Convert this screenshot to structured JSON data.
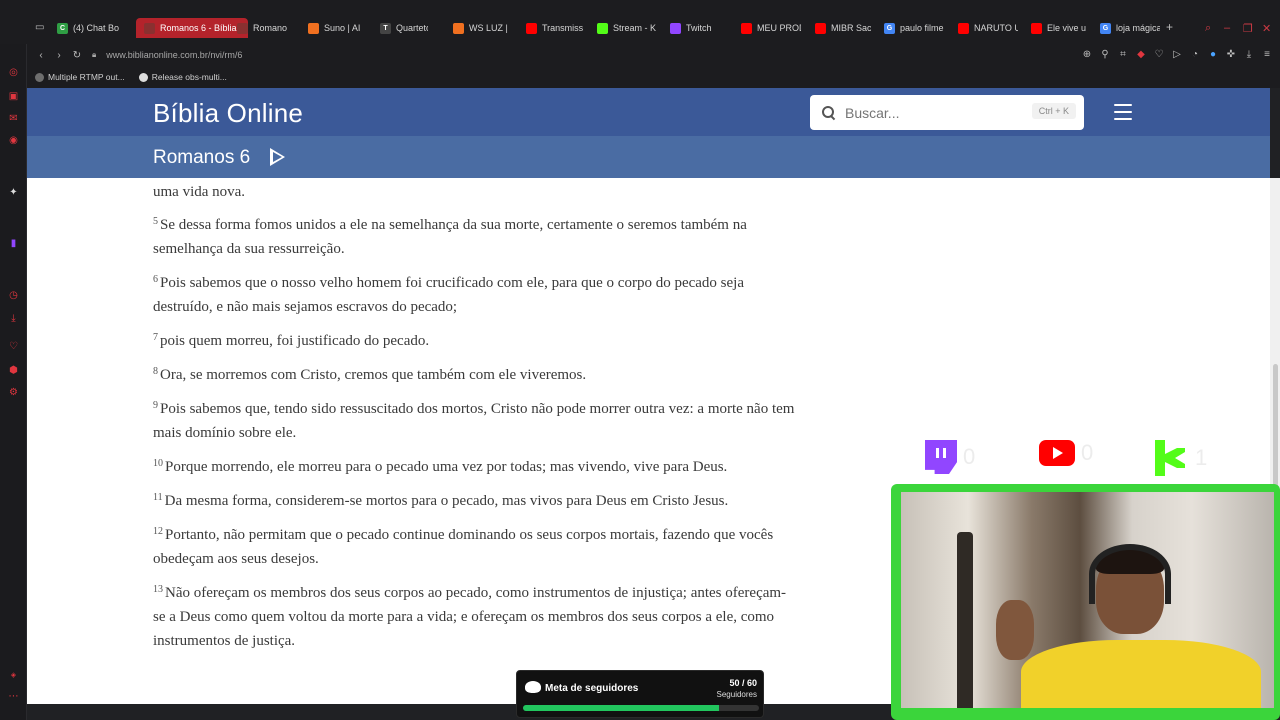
{
  "tabs": [
    {
      "label": "(4) Chat Bo",
      "color": "#2f9e44",
      "glyph": "C"
    },
    {
      "label": "Romanos 6 - Bíblia",
      "color": "#8a3030",
      "glyph": "",
      "active": true
    },
    {
      "label": "Romanos",
      "color": "#8a3030",
      "glyph": ""
    },
    {
      "label": "Suno | AI M",
      "color": "#f07020",
      "glyph": ""
    },
    {
      "label": "Quarteto",
      "color": "#444",
      "glyph": "T"
    },
    {
      "label": "WS LUZ |",
      "color": "#f07020",
      "glyph": ""
    },
    {
      "label": "Transmiss",
      "color": "#ff0000",
      "glyph": ""
    },
    {
      "label": "Stream - K",
      "color": "#53fc18",
      "glyph": ""
    },
    {
      "label": "Twitch",
      "color": "#9146ff",
      "glyph": ""
    },
    {
      "label": "MEU PROD",
      "color": "#ff0000",
      "glyph": ""
    },
    {
      "label": "MIBR Sacy",
      "color": "#ff0000",
      "glyph": ""
    },
    {
      "label": "paulo filme",
      "color": "#4285f4",
      "glyph": "G"
    },
    {
      "label": "NARUTO U",
      "color": "#ff0000",
      "glyph": ""
    },
    {
      "label": "Ele vive u",
      "color": "#ff0000",
      "glyph": ""
    },
    {
      "label": "loja mágica",
      "color": "#4285f4",
      "glyph": "G"
    }
  ],
  "browser": {
    "url": "www.biblianonline.com.br/nvi/rm/6"
  },
  "bookmarks": [
    {
      "label": "Multiple RTMP out..."
    },
    {
      "label": "Release obs-multi..."
    }
  ],
  "site": {
    "title": "Bíblia Online",
    "search_placeholder": "Buscar...",
    "search_shortcut": "Ctrl + K",
    "chapter": "Romanos 6"
  },
  "partial_verse": "uma vida nova.",
  "verses": [
    {
      "num": "5",
      "text": "Se dessa forma fomos unidos a ele na semelhança da sua morte, certamente o seremos também na semelhança da sua ressurreição."
    },
    {
      "num": "6",
      "text": "Pois sabemos que o nosso velho homem foi crucificado com ele, para que o corpo do pecado seja destruído, e não mais sejamos escravos do pecado;"
    },
    {
      "num": "7",
      "text": "pois quem morreu, foi justificado do pecado."
    },
    {
      "num": "8",
      "text": "Ora, se morremos com Cristo, cremos que também com ele viveremos."
    },
    {
      "num": "9",
      "text": "Pois sabemos que, tendo sido ressuscitado dos mortos, Cristo não pode morrer outra vez: a morte não tem mais domínio sobre ele."
    },
    {
      "num": "10",
      "text": "Porque morrendo, ele morreu para o pecado uma vez por todas; mas vivendo, vive para Deus."
    },
    {
      "num": "11",
      "text": "Da mesma forma, considerem-se mortos para o pecado, mas vivos para Deus em Cristo Jesus."
    },
    {
      "num": "12",
      "text": "Portanto, não permitam que o pecado continue dominando os seus corpos mortais, fazendo que vocês obedeçam aos seus desejos."
    },
    {
      "num": "13",
      "text": "Não ofereçam os membros dos seus corpos ao pecado, como instrumentos de injustiça; antes ofereçam-se a Deus como quem voltou da morte para a vida; e ofereçam os membros dos seus corpos a ele, como instrumentos de justiça."
    }
  ],
  "overlay": {
    "twitch_count": "0",
    "youtube_count": "0",
    "kick_count": "1",
    "goal_label": "Meta de seguidores",
    "goal_count": "50 / 60",
    "goal_unit": "Seguidores",
    "goal_progress": 0.83
  }
}
